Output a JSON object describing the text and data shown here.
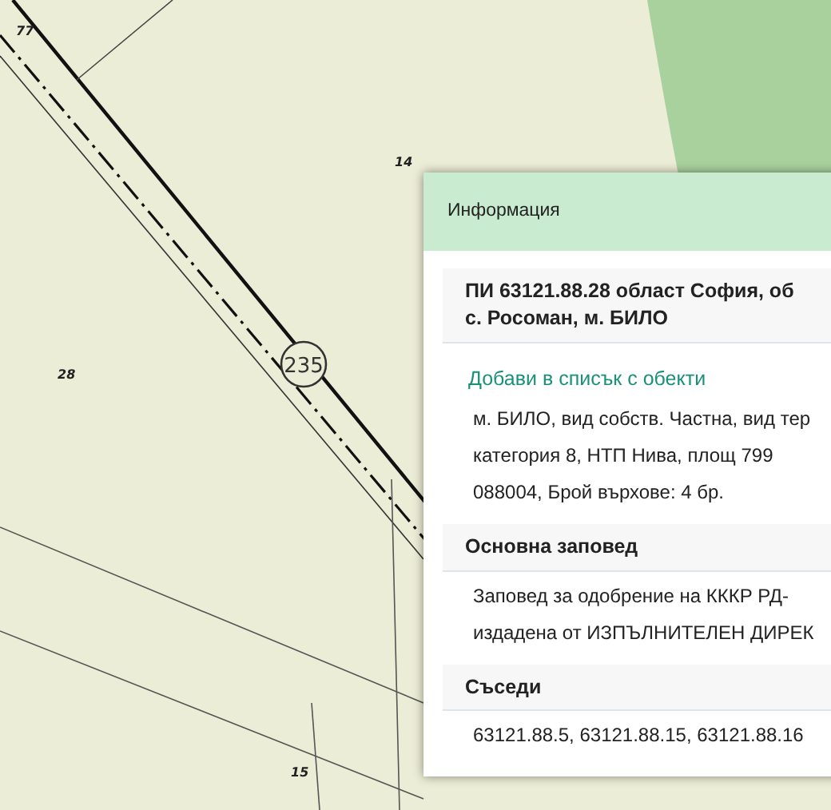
{
  "map": {
    "labels": [
      "77",
      "14",
      "28",
      "15"
    ],
    "road_number": "235"
  },
  "panel": {
    "title": "Информация",
    "heading_lines": [
      "ПИ 63121.88.28 област София, об",
      "с. Росоман, м. БИЛО"
    ],
    "link": "Добави в списък с обекти",
    "description_lines": [
      "м. БИЛО, вид собств. Частна, вид тер",
      "категория 8, НТП Нива, площ 799",
      "088004, Брой върхове: 4 бр."
    ],
    "sections": [
      {
        "title": "Основна заповед",
        "lines": [
          "Заповед за одобрение на КККР РД-",
          "издадена от ИЗПЪЛНИТЕЛЕН ДИРЕК"
        ]
      },
      {
        "title": "Съседи",
        "lines": [
          "63121.88.5, 63121.88.15, 63121.88.16"
        ]
      }
    ]
  }
}
